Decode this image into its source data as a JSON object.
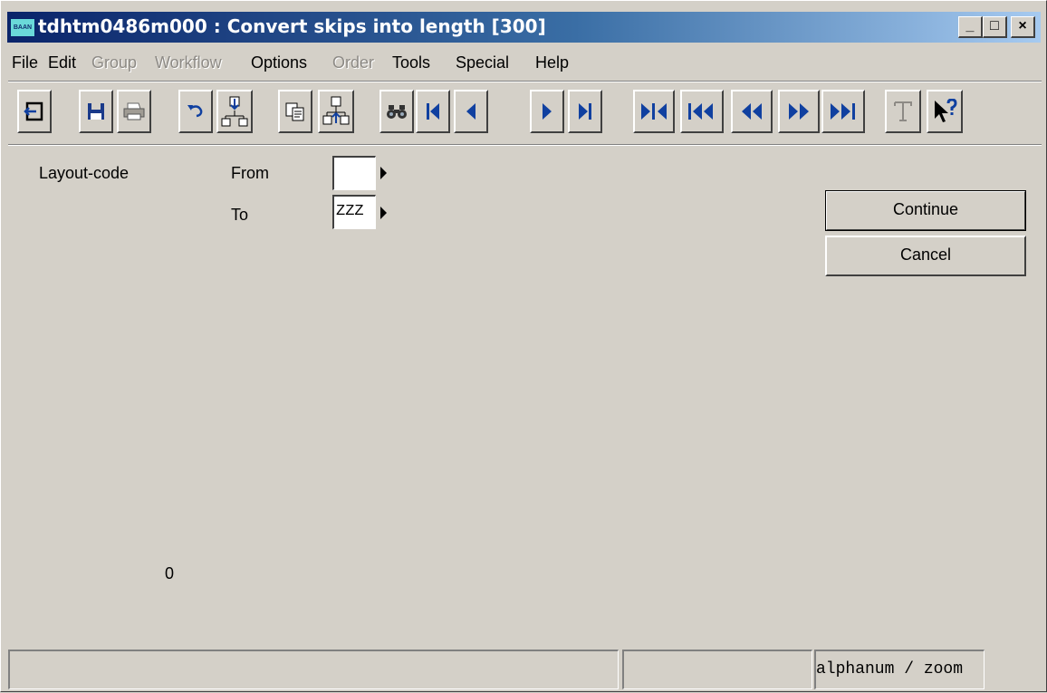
{
  "window": {
    "title": "tdhtm0486m000 : Convert skips into length [300]",
    "icon_text": "BAAN",
    "controls": {
      "minimize": "_",
      "maximize": "□",
      "close": "×"
    }
  },
  "menu": {
    "items": [
      {
        "label": "File",
        "enabled": true
      },
      {
        "label": "Edit",
        "enabled": true
      },
      {
        "label": "Group",
        "enabled": false
      },
      {
        "label": "Workflow",
        "enabled": false
      },
      {
        "label": "Options",
        "enabled": true
      },
      {
        "label": "Order",
        "enabled": false
      },
      {
        "label": "Tools",
        "enabled": true
      },
      {
        "label": "Special",
        "enabled": true
      },
      {
        "label": "Help",
        "enabled": true
      }
    ]
  },
  "toolbar": {
    "buttons": [
      "exit-icon",
      "save-icon",
      "print-icon",
      "undo-icon",
      "insert-icon",
      "copy-icon",
      "duplicate-icon",
      "find-icon",
      "first-record-icon",
      "previous-record-icon",
      "next-record-icon",
      "last-record-icon",
      "first-group-icon",
      "previous-group-set-icon",
      "previous-group-icon",
      "next-group-icon",
      "last-group-icon",
      "text-icon",
      "whats-this-help-icon"
    ]
  },
  "form": {
    "group_label": "Layout-code",
    "from_label": "From",
    "from_value": "",
    "to_label": "To",
    "to_value": "ZZZ",
    "counter": "0"
  },
  "buttons": {
    "continue": "Continue",
    "cancel": "Cancel"
  },
  "statusbar": {
    "message": "",
    "info": "",
    "mode": "alphanum / zoom"
  }
}
